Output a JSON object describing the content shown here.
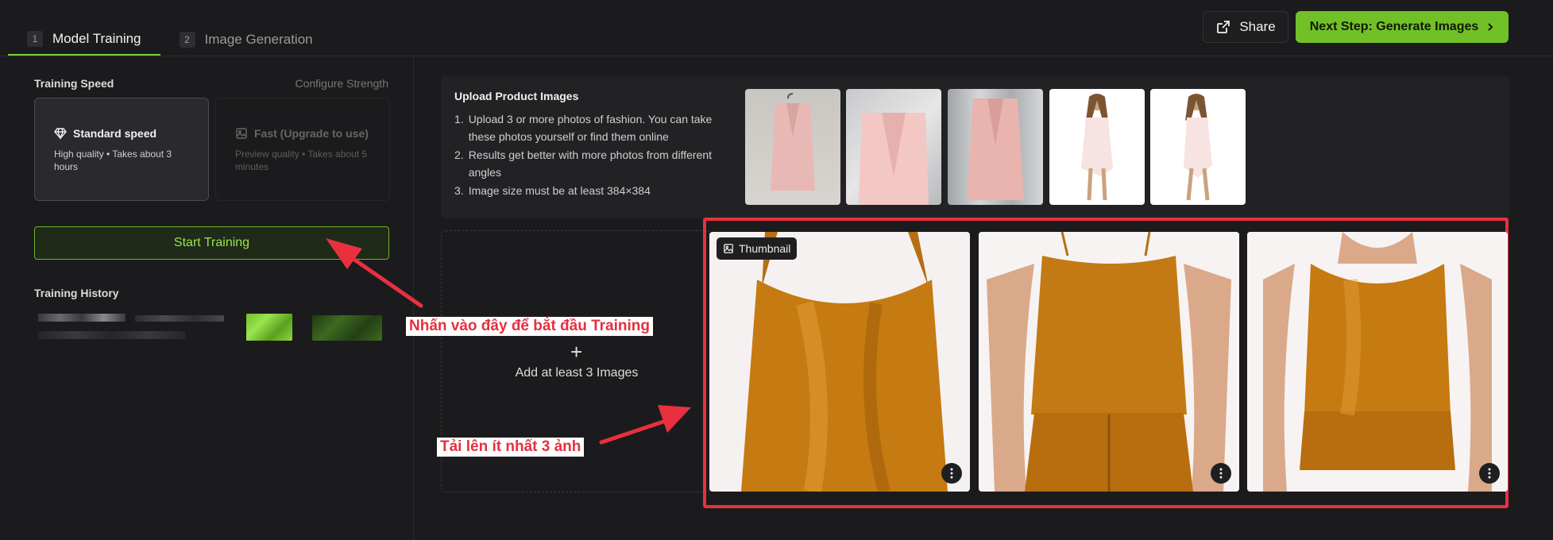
{
  "tabs": [
    {
      "number": "1",
      "label": "Model Training"
    },
    {
      "number": "2",
      "label": "Image Generation"
    }
  ],
  "header": {
    "share_label": "Share",
    "next_label": "Next Step: Generate Images"
  },
  "training": {
    "speed_label": "Training Speed",
    "configure_label": "Configure Strength",
    "standard": {
      "title": "Standard speed",
      "desc": "High quality • Takes about 3 hours"
    },
    "fast": {
      "title": "Fast (Upgrade to use)",
      "desc": "Preview quality • Takes about 5 minutes"
    },
    "start_label": "Start Training",
    "history_label": "Training History"
  },
  "upload": {
    "title": "Upload Product Images",
    "instructions": [
      {
        "num": "1.",
        "text": "Upload 3 or more photos of fashion. You can take these photos yourself or find them online"
      },
      {
        "num": "2.",
        "text": "Results get better with more photos from different angles"
      },
      {
        "num": "3.",
        "text": "Image size must be at least 384×384"
      }
    ],
    "add_label": "Add at least 3 Images",
    "plus": "+"
  },
  "thumbnail_badge": "Thumbnail",
  "annotations": {
    "start_hint": "Nhấn vào đây để bắt đầu Training",
    "upload_hint": "Tải lên ít nhất 3 ảnh"
  },
  "colors": {
    "accent": "#72c028",
    "annotation_red": "#e8303f",
    "background": "#1b1b1d"
  }
}
